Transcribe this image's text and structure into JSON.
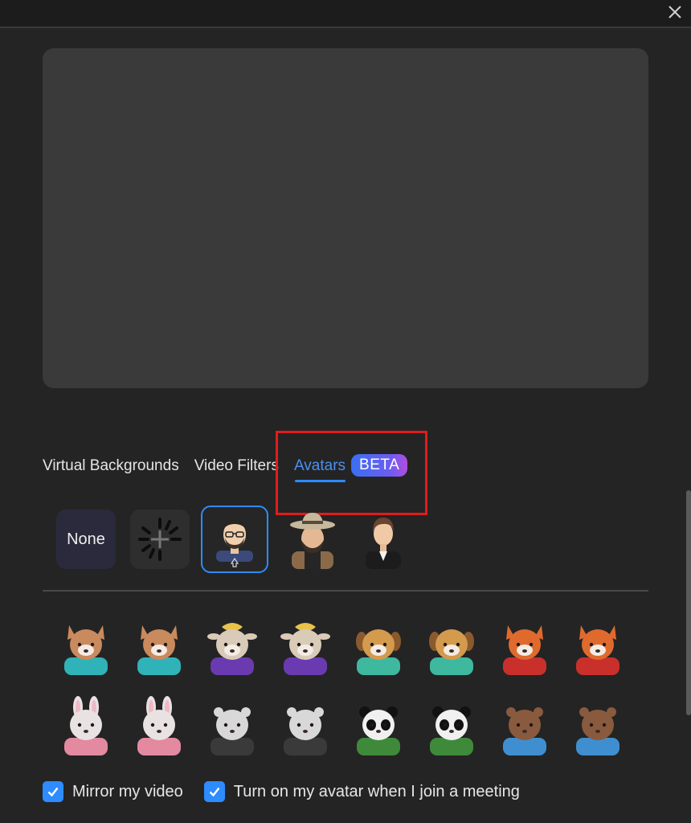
{
  "tabs": {
    "virtual_backgrounds": "Virtual Backgrounds",
    "video_filters": "Video Filters",
    "avatars": "Avatars",
    "beta": "BETA"
  },
  "avatar_row": {
    "none_label": "None"
  },
  "options": {
    "mirror": "Mirror my video",
    "avatar_on_join": "Turn on my avatar when I join a meeting",
    "mirror_checked": true,
    "avatar_on_join_checked": true
  },
  "colors": {
    "accent": "#2d8cff",
    "highlight": "#e31b1b"
  },
  "icons": {
    "close": "close-icon",
    "loading": "loading-spinner-icon",
    "favorite": "star-icon"
  },
  "animals": [
    {
      "name": "cat",
      "color": "#c98a5e",
      "shirt": "#2fb3b8"
    },
    {
      "name": "cat",
      "color": "#c98a5e",
      "shirt": "#2fb3b8"
    },
    {
      "name": "cow",
      "color": "#d9cbb8",
      "shirt": "#6a3bb0"
    },
    {
      "name": "cow",
      "color": "#d9cbb8",
      "shirt": "#6a3bb0"
    },
    {
      "name": "dog",
      "color": "#d49a4d",
      "shirt": "#3fb8a0"
    },
    {
      "name": "dog",
      "color": "#d49a4d",
      "shirt": "#3fb8a0"
    },
    {
      "name": "fox",
      "color": "#e06a2e",
      "shirt": "#c9302c"
    },
    {
      "name": "fox",
      "color": "#e06a2e",
      "shirt": "#c9302c"
    },
    {
      "name": "rabbit",
      "color": "#e8e2e2",
      "shirt": "#e38aa0"
    },
    {
      "name": "rabbit",
      "color": "#e8e2e2",
      "shirt": "#e38aa0"
    },
    {
      "name": "bear",
      "color": "#d8d8d8",
      "shirt": "#3a3a3a"
    },
    {
      "name": "bear",
      "color": "#d8d8d8",
      "shirt": "#3a3a3a"
    },
    {
      "name": "panda",
      "color": "#f0f0f0",
      "shirt": "#3e8a3a"
    },
    {
      "name": "panda",
      "color": "#f0f0f0",
      "shirt": "#3e8a3a"
    },
    {
      "name": "otter",
      "color": "#8a5a3e",
      "shirt": "#3f8fd0"
    },
    {
      "name": "otter",
      "color": "#8a5a3e",
      "shirt": "#3f8fd0"
    }
  ]
}
